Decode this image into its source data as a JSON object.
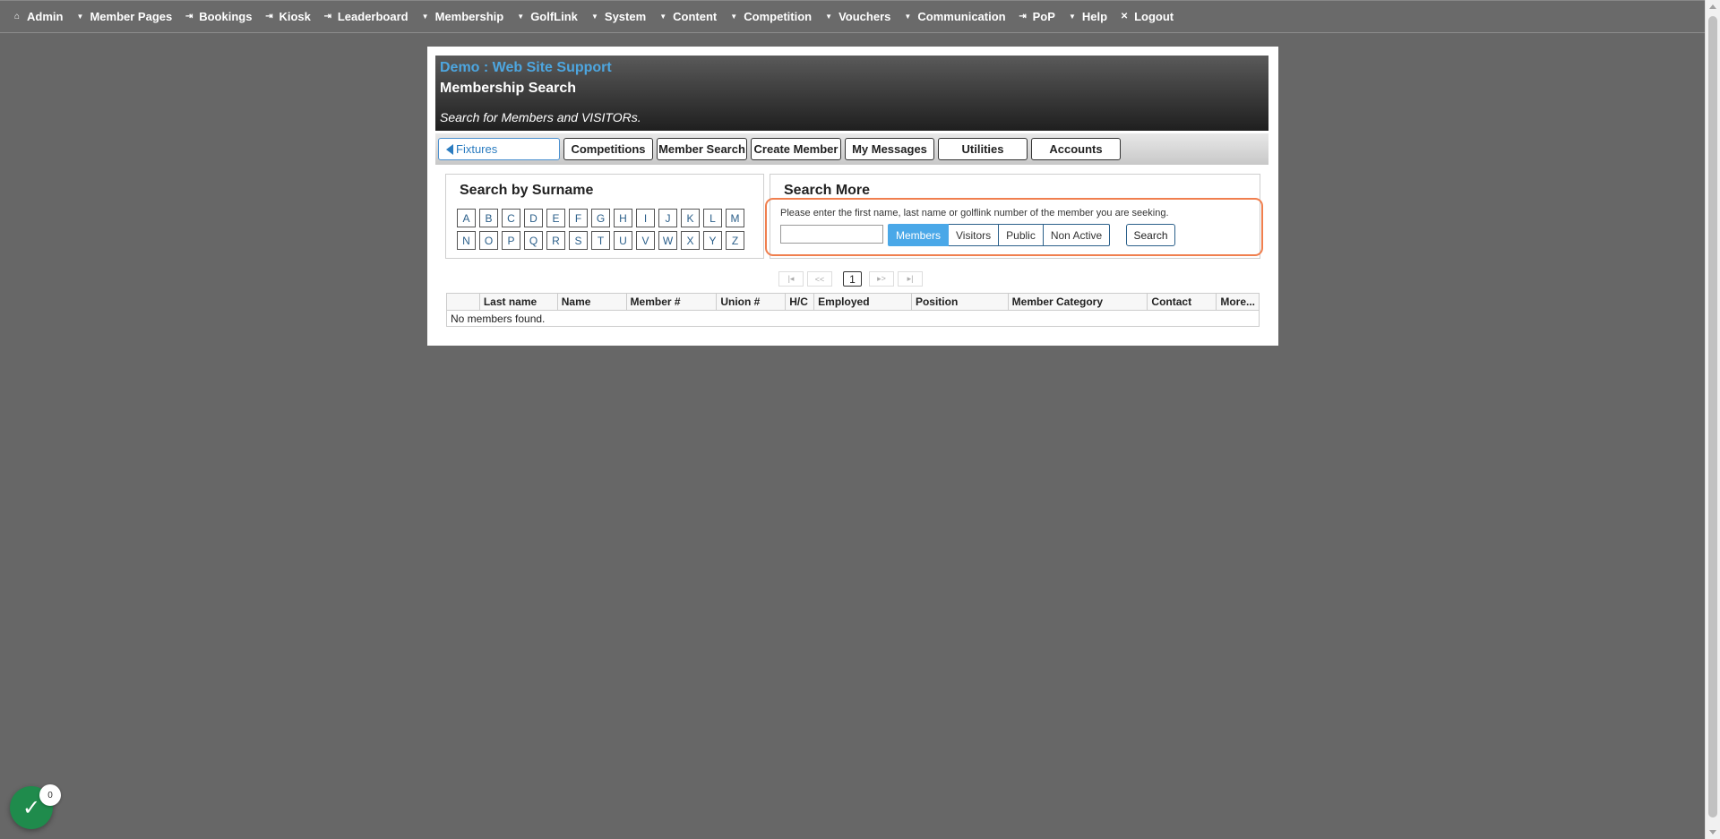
{
  "topnav": {
    "items": [
      {
        "icon": "home-icon",
        "glyph": "⌂",
        "label": "Admin"
      },
      {
        "icon": "caret-down-icon",
        "glyph": "▼",
        "label": "Member Pages"
      },
      {
        "icon": "link-icon",
        "glyph": "⇥",
        "label": "Bookings"
      },
      {
        "icon": "link-icon",
        "glyph": "⇥",
        "label": "Kiosk"
      },
      {
        "icon": "link-icon",
        "glyph": "⇥",
        "label": "Leaderboard"
      },
      {
        "icon": "caret-down-icon",
        "glyph": "▼",
        "label": "Membership"
      },
      {
        "icon": "caret-down-icon",
        "glyph": "▼",
        "label": "GolfLink"
      },
      {
        "icon": "caret-down-icon",
        "glyph": "▼",
        "label": "System"
      },
      {
        "icon": "caret-down-icon",
        "glyph": "▼",
        "label": "Content"
      },
      {
        "icon": "caret-down-icon",
        "glyph": "▼",
        "label": "Competition"
      },
      {
        "icon": "caret-down-icon",
        "glyph": "▼",
        "label": "Vouchers"
      },
      {
        "icon": "caret-down-icon",
        "glyph": "▼",
        "label": "Communication"
      },
      {
        "icon": "link-icon",
        "glyph": "⇥",
        "label": "PoP"
      },
      {
        "icon": "caret-down-icon",
        "glyph": "▼",
        "label": "Help"
      },
      {
        "icon": "close-icon",
        "glyph": "✕",
        "label": "Logout"
      }
    ]
  },
  "header": {
    "site_title": "Demo : Web Site Support",
    "page_title": "Membership Search",
    "subtitle": "Search for Members and VISITORs."
  },
  "tabs": [
    {
      "label": "Fixtures",
      "back": true
    },
    {
      "label": "Competitions"
    },
    {
      "label": "Member Search"
    },
    {
      "label": "Create Member"
    },
    {
      "label": "My Messages"
    },
    {
      "label": "Utilities"
    },
    {
      "label": "Accounts"
    }
  ],
  "surname": {
    "title": "Search by Surname",
    "row1": [
      "A",
      "B",
      "C",
      "D",
      "E",
      "F",
      "G",
      "H",
      "I",
      "J",
      "K",
      "L",
      "M"
    ],
    "row2": [
      "N",
      "O",
      "P",
      "Q",
      "R",
      "S",
      "T",
      "U",
      "V",
      "W",
      "X",
      "Y",
      "Z"
    ]
  },
  "search_more": {
    "title": "Search More",
    "hint": "Please enter the first name, last name or golflink number of the member you are seeking.",
    "input_value": "",
    "filters": [
      "Members",
      "Visitors",
      "Public",
      "Non Active"
    ],
    "active_filter": "Members",
    "search_label": "Search"
  },
  "pager": {
    "first": "|◂",
    "prev": "<<",
    "current": "1",
    "next": "▸>",
    "last": "▸|"
  },
  "table": {
    "columns": [
      "",
      "Last name",
      "Name",
      "Member #",
      "Union #",
      "H/C",
      "Employed",
      "Position",
      "Member Category",
      "Contact",
      "More..."
    ],
    "empty_message": "No members found."
  },
  "fab": {
    "icon": "check-icon",
    "count": "0",
    "color": "#1f8b4c"
  },
  "colors": {
    "accent": "#4aa8e8",
    "highlight": "#f07f4e",
    "background": "#676767"
  }
}
